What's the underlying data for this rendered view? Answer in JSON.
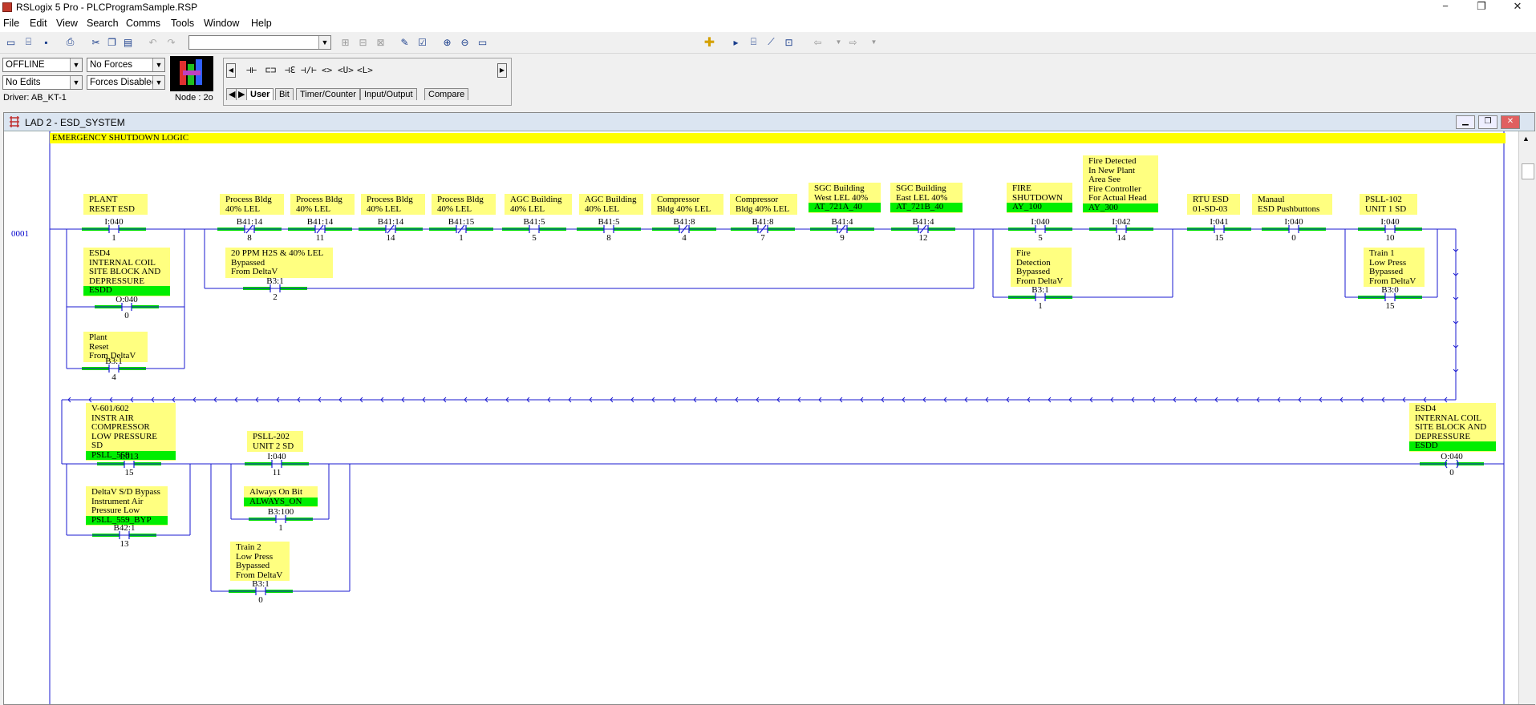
{
  "app": {
    "title": "RSLogix 5 Pro - PLCProgramSample.RSP",
    "minimize": "−",
    "maximize": "❐",
    "close": "✕"
  },
  "menu": [
    "File",
    "Edit",
    "View",
    "Search",
    "Comms",
    "Tools",
    "Window",
    "Help"
  ],
  "status": {
    "mode": "OFFLINE",
    "forces": "No Forces",
    "edits": "No Edits",
    "forces_state": "Forces Disabled",
    "driver": "Driver: AB_KT-1",
    "node": "Node :  2o"
  },
  "instruction_bar": {
    "instructions": [
      "⊣⊢",
      "⊏⊐",
      "⊣ℇ",
      "⊣/⊢",
      "<>",
      "<U>",
      "<L>"
    ],
    "tabs": [
      "User",
      "Bit",
      "Timer/Counter",
      "Input/Output",
      "Compare"
    ]
  },
  "ladder_window": {
    "title": "LAD 2 - ESD_SYSTEM",
    "header_comment": "EMERGENCY SHUTDOWN LOGIC",
    "rung_number": "0001",
    "elements": [
      {
        "lines": [
          "PLANT",
          "RESET ESD"
        ],
        "sym": "",
        "addr": "I:040",
        "bit": "1"
      },
      {
        "lines": [
          "ESD4",
          "INTERNAL COIL",
          "SITE BLOCK AND",
          "DEPRESSURE"
        ],
        "sym": "ESDD",
        "addr": "O:040",
        "bit": "0"
      },
      {
        "lines": [
          "Plant",
          "Reset",
          "From DeltaV"
        ],
        "sym": "",
        "addr": "B3:1",
        "bit": "4"
      },
      {
        "lines": [
          "Process Bldg",
          "40% LEL"
        ],
        "sym": "",
        "addr": "B41:14",
        "bit": "8"
      },
      {
        "lines": [
          "Process Bldg",
          "40% LEL"
        ],
        "sym": "",
        "addr": "B41:14",
        "bit": "11"
      },
      {
        "lines": [
          "Process Bldg",
          "40% LEL"
        ],
        "sym": "",
        "addr": "B41:14",
        "bit": "14"
      },
      {
        "lines": [
          "Process Bldg",
          "40% LEL"
        ],
        "sym": "",
        "addr": "B41:15",
        "bit": "1"
      },
      {
        "lines": [
          "AGC Building",
          "40% LEL"
        ],
        "sym": "",
        "addr": "B41:5",
        "bit": "5"
      },
      {
        "lines": [
          "AGC Building",
          "40% LEL"
        ],
        "sym": "",
        "addr": "B41:5",
        "bit": "8"
      },
      {
        "lines": [
          "Compressor",
          "Bldg 40% LEL"
        ],
        "sym": "",
        "addr": "B41:8",
        "bit": "4"
      },
      {
        "lines": [
          "Compressor",
          "Bldg 40% LEL"
        ],
        "sym": "",
        "addr": "B41:8",
        "bit": "7"
      },
      {
        "lines": [
          "SGC Building",
          "West LEL 40%"
        ],
        "sym": "AT_721A_40",
        "addr": "B41:4",
        "bit": "9"
      },
      {
        "lines": [
          "SGC Building",
          "East LEL 40%"
        ],
        "sym": "AT_721B_40",
        "addr": "B41:4",
        "bit": "12"
      },
      {
        "lines": [
          "20 PPM H2S & 40% LEL",
          "Bypassed",
          "From DeltaV"
        ],
        "sym": "",
        "addr": "B3:1",
        "bit": "2"
      },
      {
        "lines": [
          "FIRE",
          "SHUTDOWN"
        ],
        "sym": "AY_100",
        "addr": "I:040",
        "bit": "5"
      },
      {
        "lines": [
          "Fire Detected",
          "In New Plant",
          "Area See",
          "Fire Controller",
          "For Actual Head"
        ],
        "sym": "AY_300",
        "addr": "I:042",
        "bit": "14"
      },
      {
        "lines": [
          "Fire",
          "Detection",
          "Bypassed",
          "From DeltaV"
        ],
        "sym": "",
        "addr": "B3:1",
        "bit": "1"
      },
      {
        "lines": [
          "RTU ESD",
          "01-SD-03"
        ],
        "sym": "",
        "addr": "I:041",
        "bit": "15"
      },
      {
        "lines": [
          "Manaul",
          "ESD Pushbuttons"
        ],
        "sym": "",
        "addr": "I:040",
        "bit": "0"
      },
      {
        "lines": [
          "PSLL-102",
          "UNIT 1 SD"
        ],
        "sym": "",
        "addr": "I:040",
        "bit": "10"
      },
      {
        "lines": [
          "Train 1",
          "Low Press",
          "Bypassed",
          "From DeltaV"
        ],
        "sym": "",
        "addr": "B3:0",
        "bit": "15"
      },
      {
        "lines": [
          "V-601/602",
          "INSTR AIR",
          "COMPRESSOR",
          "LOW PRESSURE SD"
        ],
        "sym": "PSLL_559",
        "addr": "I:013",
        "bit": "15"
      },
      {
        "lines": [
          "DeltaV S/D Bypass",
          "Instrument Air",
          "Pressure Low"
        ],
        "sym": "PSLL_559_BYP",
        "addr": "B42:1",
        "bit": "13"
      },
      {
        "lines": [
          "PSLL-202",
          "UNIT 2 SD"
        ],
        "sym": "",
        "addr": "I:040",
        "bit": "11"
      },
      {
        "lines": [
          "Always On Bit"
        ],
        "sym": "ALWAYS_ON",
        "addr": "B3:100",
        "bit": "1"
      },
      {
        "lines": [
          "Train 2",
          "Low Press",
          "Bypassed",
          "From DeltaV"
        ],
        "sym": "",
        "addr": "B3:1",
        "bit": "0"
      },
      {
        "lines": [
          "ESD4",
          "INTERNAL COIL",
          "SITE BLOCK AND",
          "DEPRESSURE"
        ],
        "sym": "ESDD",
        "addr": "O:040",
        "bit": "0"
      }
    ]
  }
}
